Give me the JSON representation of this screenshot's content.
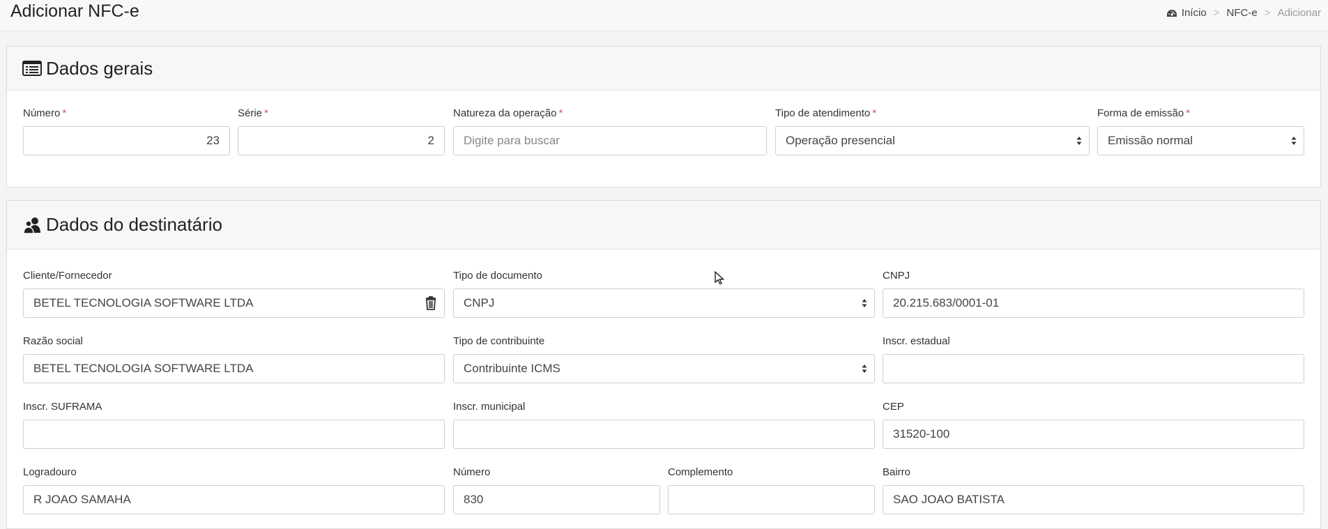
{
  "header": {
    "title": "Adicionar NFC-e",
    "breadcrumb": [
      {
        "label": "Início",
        "icon": "dashboard-icon"
      },
      {
        "label": "NFC-e"
      },
      {
        "label": "Adicionar"
      }
    ],
    "separator": ">"
  },
  "dados_gerais": {
    "title": "Dados gerais",
    "icon": "list-icon",
    "required_mark": "*",
    "numero": {
      "label": "Número",
      "value": "23"
    },
    "serie": {
      "label": "Série",
      "value": "2"
    },
    "natureza": {
      "label": "Natureza da operação",
      "placeholder": "Digite para buscar"
    },
    "tipo_atendimento": {
      "label": "Tipo de atendimento",
      "value": "Operação presencial"
    },
    "forma_emissao": {
      "label": "Forma de emissão",
      "value": "Emissão normal"
    }
  },
  "destinatario": {
    "title": "Dados do destinatário",
    "icon": "users-icon",
    "cliente": {
      "label": "Cliente/Fornecedor",
      "value": "BETEL TECNOLOGIA SOFTWARE LTDA"
    },
    "tipo_documento": {
      "label": "Tipo de documento",
      "value": "CNPJ"
    },
    "cnpj": {
      "label": "CNPJ",
      "value": "20.215.683/0001-01"
    },
    "razao_social": {
      "label": "Razão social",
      "value": "BETEL TECNOLOGIA SOFTWARE LTDA"
    },
    "tipo_contribuinte": {
      "label": "Tipo de contribuinte",
      "value": "Contribuinte ICMS"
    },
    "inscr_estadual": {
      "label": "Inscr. estadual",
      "value": ""
    },
    "inscr_suframa": {
      "label": "Inscr. SUFRAMA",
      "value": ""
    },
    "inscr_municipal": {
      "label": "Inscr. municipal",
      "value": ""
    },
    "cep": {
      "label": "CEP",
      "value": "31520-100"
    },
    "logradouro": {
      "label": "Logradouro",
      "value": "R JOAO SAMAHA"
    },
    "numero": {
      "label": "Número",
      "value": "830"
    },
    "complemento": {
      "label": "Complemento",
      "value": ""
    },
    "bairro": {
      "label": "Bairro",
      "value": "SAO JOAO BATISTA"
    }
  },
  "colors": {
    "required": "#d9534f",
    "border": "#cfcfcf"
  }
}
